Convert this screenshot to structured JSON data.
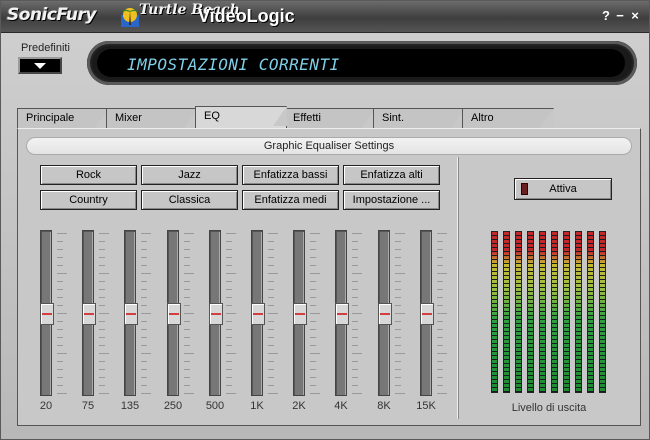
{
  "titlebar": {
    "brand_sonic": "SonicFury",
    "brand_turtle": "Turtle Beach",
    "brand_videologic": "VideoLogic",
    "help": "?",
    "minimize": "−",
    "close": "×"
  },
  "presets": {
    "label": "Predefiniti"
  },
  "display": {
    "text": "IMPOSTAZIONI CORRENTI"
  },
  "tabs": [
    {
      "label": "Principale"
    },
    {
      "label": "Mixer"
    },
    {
      "label": "EQ"
    },
    {
      "label": "Effetti"
    },
    {
      "label": "Sint."
    },
    {
      "label": "Altro"
    }
  ],
  "active_tab": "EQ",
  "panel": {
    "title": "Graphic Equaliser Settings"
  },
  "eq_presets": [
    "Rock",
    "Jazz",
    "Enfatizza bassi",
    "Enfatizza alti",
    "Country",
    "Classica",
    "Enfatizza medi",
    "Impostazione ..."
  ],
  "bands": [
    {
      "freq": "20",
      "level": 0.5
    },
    {
      "freq": "75",
      "level": 0.5
    },
    {
      "freq": "135",
      "level": 0.5
    },
    {
      "freq": "250",
      "level": 0.5
    },
    {
      "freq": "500",
      "level": 0.5
    },
    {
      "freq": "1K",
      "level": 0.5
    },
    {
      "freq": "2K",
      "level": 0.5
    },
    {
      "freq": "4K",
      "level": 0.5
    },
    {
      "freq": "8K",
      "level": 0.5
    },
    {
      "freq": "15K",
      "level": 0.5
    }
  ],
  "activate": {
    "label": "Attiva"
  },
  "meters": {
    "count": 10,
    "label": "Livello di uscita"
  },
  "colors": {
    "display_text": "#7fcfe8",
    "led_off": "#6a2020",
    "meter_red": "#c0282c",
    "meter_green": "#1c8c34"
  }
}
